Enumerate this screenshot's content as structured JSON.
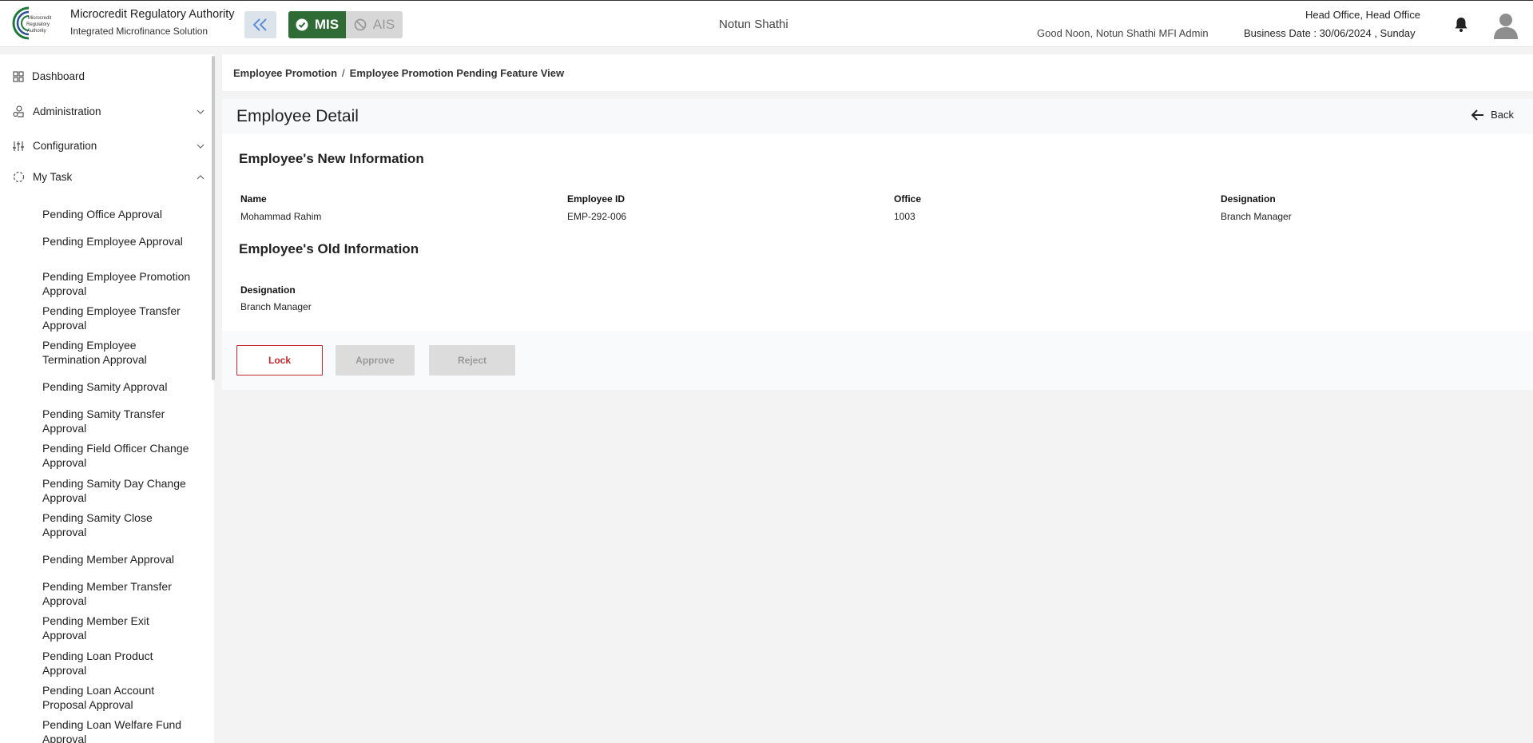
{
  "header": {
    "brand_title": "Microcredit Regulatory Authority",
    "brand_subtitle": "Integrated Microfinance Solution",
    "logo_text": "Microcredit Regulatory Authority",
    "mode_mis": "MIS",
    "mode_ais": "AIS",
    "center_title": "Notun Shathi",
    "greeting": "Good Noon, Notun Shathi MFI Admin",
    "office": "Head Office, Head Office",
    "business_date": "Business Date : 30/06/2024 , Sunday",
    "icons": [
      "double-chevron-left-icon",
      "check-circle-icon",
      "ban-icon",
      "bell-icon",
      "user-avatar-icon"
    ]
  },
  "sidebar": {
    "items": [
      {
        "label": "Dashboard",
        "icon": "grid-icon"
      },
      {
        "label": "Administration",
        "icon": "admin-icon"
      },
      {
        "label": "Configuration",
        "icon": "sliders-icon"
      },
      {
        "label": "My Task",
        "icon": "task-icon"
      }
    ],
    "subitems": [
      "Pending Office Approval",
      "Pending Employee Approval",
      "Pending Employee Promotion Approval",
      "Pending Employee Transfer Approval",
      "Pending Employee Termination Approval",
      "Pending Samity Approval",
      "Pending Samity Transfer Approval",
      "Pending Field Officer Change Approval",
      "Pending Samity Day Change Approval",
      "Pending Samity Close Approval",
      "Pending Member Approval",
      "Pending Member Transfer Approval",
      "Pending Member Exit Approval",
      "Pending Loan Product Approval",
      "Pending Loan Account Proposal Approval",
      "Pending Loan Welfare Fund Approval"
    ]
  },
  "breadcrumb": {
    "parent": "Employee Promotion",
    "separator": "/",
    "current": "Employee Promotion Pending Feature View"
  },
  "detail": {
    "title": "Employee Detail",
    "back_label": "Back",
    "new_info": {
      "heading": "Employee's New Information",
      "name_label": "Name",
      "name_value": "Mohammad Rahim",
      "id_label": "Employee ID",
      "id_value": "EMP-292-006",
      "office_label": "Office",
      "office_value": "1003",
      "designation_label": "Designation",
      "designation_value": "Branch Manager"
    },
    "old_info": {
      "heading": "Employee's Old Information",
      "designation_label": "Designation",
      "designation_value": "Branch Manager"
    },
    "actions": {
      "lock": "Lock",
      "approve": "Approve",
      "reject": "Reject"
    }
  },
  "colors": {
    "mis_active": "#2e6b35",
    "lock_border": "#c6242e",
    "disabled_bg": "#dcdcdc"
  }
}
